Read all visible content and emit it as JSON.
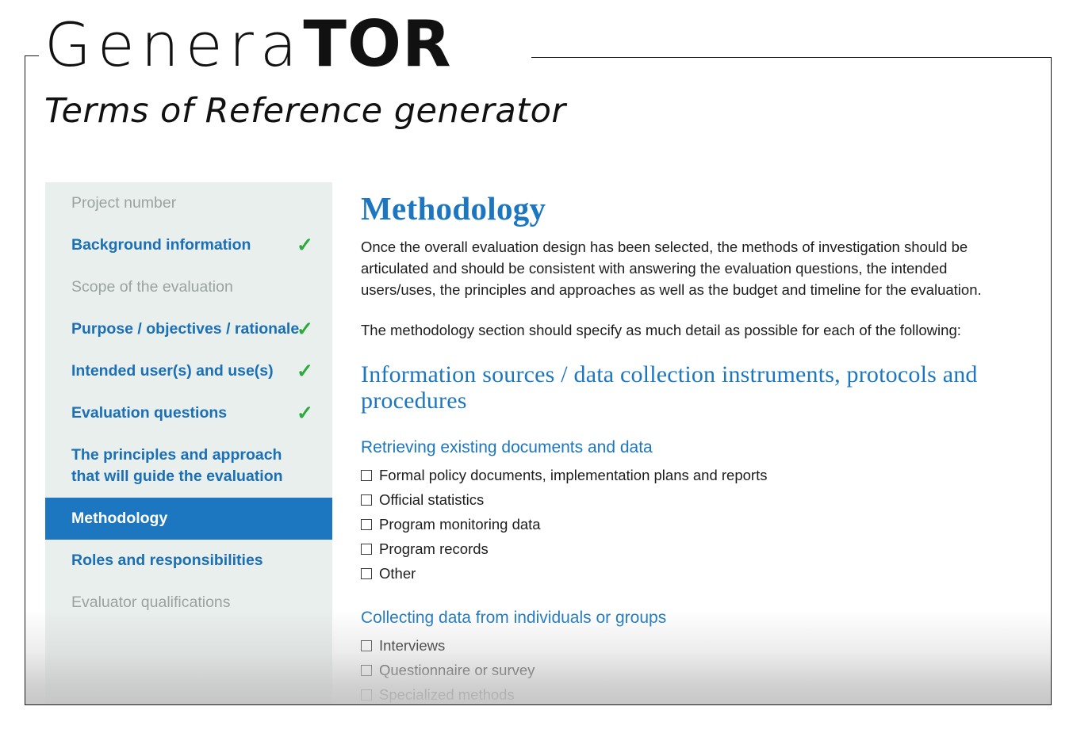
{
  "logo": {
    "word_light": "Genera",
    "word_bold": "TOR",
    "subtitle": "Terms of Reference generator"
  },
  "colors": {
    "accent_blue": "#1c77c0",
    "heading_blue": "#1a6fb5",
    "check_green": "#2eaa3c",
    "sidebar_bg": "#e9efed",
    "body_text": "#1d1d1d",
    "disabled_text": "#9aa3a1"
  },
  "sidebar": {
    "items": [
      {
        "label": "Project number",
        "state": "disabled",
        "checked": false,
        "check_icon": ""
      },
      {
        "label": "Background information",
        "state": "enabled",
        "checked": true,
        "check_icon": "✓"
      },
      {
        "label": "Scope of the evaluation",
        "state": "disabled",
        "checked": false,
        "check_icon": ""
      },
      {
        "label": "Purpose / objectives / rationale",
        "state": "enabled",
        "checked": true,
        "check_icon": "✓"
      },
      {
        "label": "Intended user(s) and use(s)",
        "state": "enabled",
        "checked": true,
        "check_icon": "✓"
      },
      {
        "label": "Evaluation questions",
        "state": "enabled",
        "checked": true,
        "check_icon": "✓"
      },
      {
        "label": "The principles and approach that will guide the evaluation",
        "state": "enabled",
        "checked": false,
        "check_icon": ""
      },
      {
        "label": "Methodology",
        "state": "active",
        "checked": false,
        "check_icon": ""
      },
      {
        "label": "Roles and responsibilities",
        "state": "enabled",
        "checked": false,
        "check_icon": ""
      },
      {
        "label": "Evaluator qualifications",
        "state": "disabled",
        "checked": false,
        "check_icon": ""
      }
    ]
  },
  "main": {
    "title": "Methodology",
    "paragraph_1": "Once the overall evaluation design has been selected, the methods of investigation should be articulated and should be consistent with answering the evaluation questions, the intended users/uses, the principles and approaches as well as the budget and timeline for the evaluation.",
    "paragraph_2": "The methodology section should specify as much detail as possible for each of the following:",
    "section_heading": "Information sources / data collection instruments, protocols and procedures",
    "groups": [
      {
        "heading": "Retrieving existing documents and data",
        "options": [
          {
            "label": "Formal policy documents, implementation plans and reports",
            "checked": false
          },
          {
            "label": "Official statistics",
            "checked": false
          },
          {
            "label": "Program monitoring data",
            "checked": false
          },
          {
            "label": "Program records",
            "checked": false
          },
          {
            "label": "Other",
            "checked": false
          }
        ]
      },
      {
        "heading": "Collecting data from individuals or groups",
        "options": [
          {
            "label": "Interviews",
            "checked": false
          },
          {
            "label": "Questionnaire or survey",
            "checked": false
          },
          {
            "label": "Specialized methods",
            "checked": false
          }
        ]
      }
    ]
  }
}
